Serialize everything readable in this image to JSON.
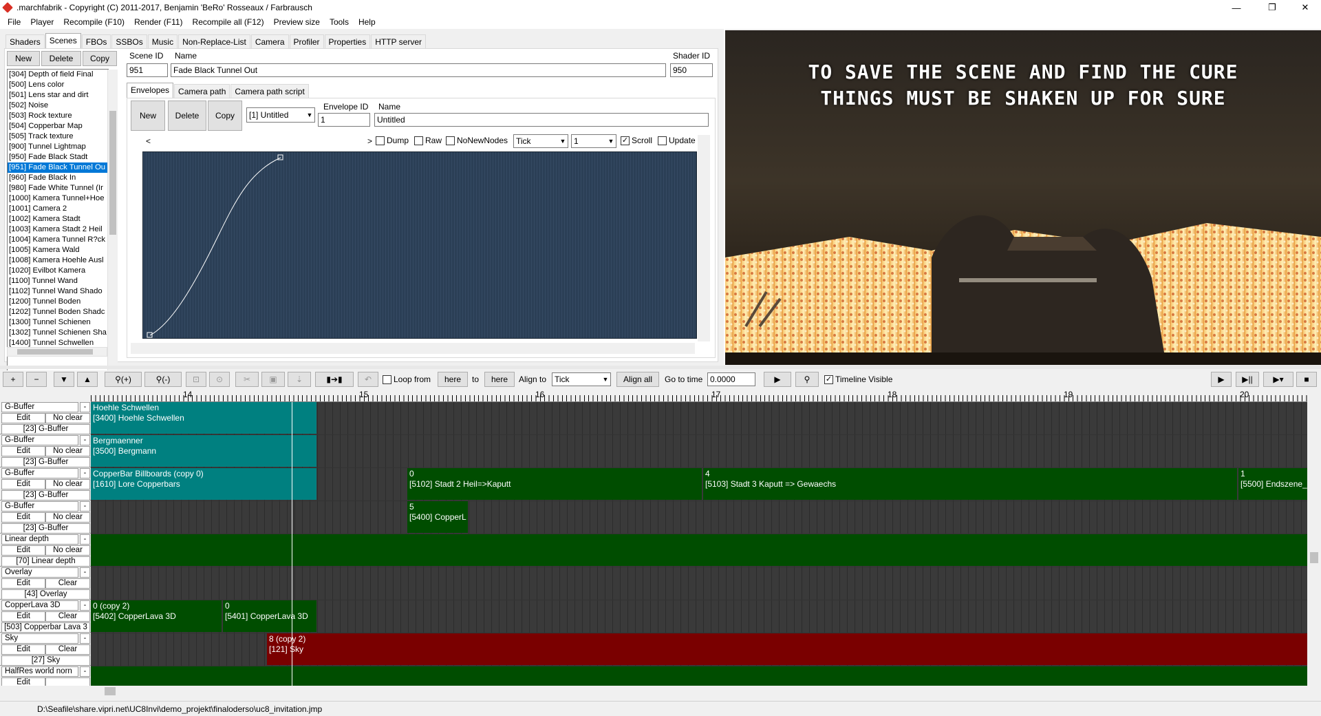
{
  "window": {
    "title": ".marchfabrik - Copyright (C) 2011-2017, Benjamin 'BeRo' Rosseaux / Farbrausch",
    "minimize": "—",
    "maximize": "❐",
    "close": "✕"
  },
  "menu": [
    "File",
    "Player",
    "Recompile (F10)",
    "Render (F11)",
    "Recompile all (F12)",
    "Preview size",
    "Tools",
    "Help"
  ],
  "main_tabs": [
    "Shaders",
    "Scenes",
    "FBOs",
    "SSBOs",
    "Music",
    "Non-Replace-List",
    "Camera",
    "Profiler",
    "Properties",
    "HTTP server"
  ],
  "scene_buttons": {
    "new": "New",
    "delete": "Delete",
    "copy": "Copy"
  },
  "scene_list": [
    "[304] Depth of field Final",
    "[500] Lens color",
    "[501] Lens star and dirt",
    "[502] Noise",
    "[503] Rock texture",
    "[504] Copperbar Map",
    "[505] Track texture",
    "[900] Tunnel Lightmap",
    "[950] Fade Black Stadt",
    "[951] Fade Black Tunnel Ou",
    "[960] Fade Black In",
    "[980] Fade White Tunnel (Ir",
    "[1000] Kamera Tunnel+Hoe",
    "[1001] Camera 2",
    "[1002] Kamera Stadt",
    "[1003] Kamera Stadt 2 Heil",
    "[1004] Kamera Tunnel R?ck",
    "[1005] Kamera Wald",
    "[1008] Kamera Hoehle Ausl",
    "[1020] Evilbot Kamera",
    "[1100] Tunnel Wand",
    "[1102] Tunnel Wand Shado",
    "[1200] Tunnel Boden",
    "[1202] Tunnel Boden Shadc",
    "[1300] Tunnel Schienen",
    "[1302] Tunnel Schienen Sha",
    "[1400] Tunnel Schwellen"
  ],
  "scene_selected_index": 9,
  "scene_form": {
    "id_label": "Scene ID",
    "id_value": "951",
    "name_label": "Name",
    "name_value": "Fade Black Tunnel Out",
    "shader_label": "Shader ID",
    "shader_value": "950"
  },
  "sub_tabs": [
    "Envelopes",
    "Camera path",
    "Camera path script"
  ],
  "envelope": {
    "new": "New",
    "delete": "Delete",
    "copy": "Copy",
    "select_value": "[1] Untitled",
    "id_label": "Envelope ID",
    "id_value": "1",
    "name_label": "Name",
    "name_value": "Untitled",
    "dump": "Dump",
    "raw": "Raw",
    "nonewnodes": "NoNewNodes",
    "mode_value": "Tick",
    "step_value": "1",
    "scroll": "Scroll",
    "update": "Update"
  },
  "preview_text": [
    "TO SAVE THE SCENE AND FIND THE CURE",
    "THINGS MUST BE SHAKEN UP FOR SURE"
  ],
  "timeline_toolbar": {
    "loop_from": "Loop from",
    "here": "here",
    "to": "to",
    "here2": "here",
    "align_to": "Align to",
    "align_value": "Tick",
    "align_all": "Align all",
    "go_to_time": "Go to time",
    "time_value": "0.0000",
    "timeline_visible": "Timeline Visible"
  },
  "ruler_labels": [
    "14",
    "15",
    "16",
    "17",
    "18",
    "19",
    "20"
  ],
  "tracks": [
    {
      "name": "G-Buffer",
      "edit": "Edit",
      "clear": "No clear",
      "ref": "[23] G-Buffer"
    },
    {
      "name": "G-Buffer",
      "edit": "Edit",
      "clear": "No clear",
      "ref": "[23] G-Buffer"
    },
    {
      "name": "G-Buffer",
      "edit": "Edit",
      "clear": "No clear",
      "ref": "[23] G-Buffer"
    },
    {
      "name": "G-Buffer",
      "edit": "Edit",
      "clear": "No clear",
      "ref": "[23] G-Buffer"
    },
    {
      "name": "Linear depth",
      "edit": "Edit",
      "clear": "No clear",
      "ref": "[70] Linear depth"
    },
    {
      "name": "Overlay",
      "edit": "Edit",
      "clear": "Clear",
      "ref": "[43] Overlay"
    },
    {
      "name": "CopperLava 3D",
      "edit": "Edit",
      "clear": "Clear",
      "ref": "[503] Copperbar Lava 3"
    },
    {
      "name": "Sky",
      "edit": "Edit",
      "clear": "Clear",
      "ref": "[27] Sky"
    },
    {
      "name": "HalfRes world norn",
      "edit": "Edit",
      "clear": "",
      "ref": ""
    }
  ],
  "clips": [
    {
      "track": 0,
      "l1": "Hoehle Schwellen",
      "l2": "[3400] Hoehle Schwellen",
      "color": "#008080"
    },
    {
      "track": 1,
      "l1": "Bergmaenner",
      "l2": "[3500] Bergmann",
      "color": "#008080"
    },
    {
      "track": 2,
      "l1": "CopperBar Billboards (copy 0)",
      "l2": "[1610] Lore Copperbars",
      "color": "#008080"
    },
    {
      "track": 2,
      "l1": "0",
      "l2": "[5102] Stadt 2 Heil=>Kaputt",
      "color": "#004d00"
    },
    {
      "track": 2,
      "l1": "4",
      "l2": "[5103] Stadt 3 Kaputt => Gewaechs",
      "color": "#004d00"
    },
    {
      "track": 2,
      "l1": "1",
      "l2": "[5500] Endszene_",
      "color": "#004d00"
    },
    {
      "track": 3,
      "l1": "5",
      "l2": "[5400] CopperL",
      "color": "#004d00"
    },
    {
      "track": 4,
      "l1": "",
      "l2": "",
      "color": "#004d00"
    },
    {
      "track": 6,
      "l1": "0 (copy 2)",
      "l2": "[5402] CopperLava 3D",
      "color": "#004d00"
    },
    {
      "track": 6,
      "l1": "0",
      "l2": "[5401] CopperLava 3D",
      "color": "#004d00"
    },
    {
      "track": 7,
      "l1": "8 (copy 2)",
      "l2": "[121] Sky",
      "color": "#7a0000"
    },
    {
      "track": 8,
      "l1": "",
      "l2": "",
      "color": "#004d00"
    }
  ],
  "status_path": "D:\\Seafile\\share.vipri.net\\UC8Invi\\demo_projekt\\finaloderso\\uc8_invitation.jmp"
}
